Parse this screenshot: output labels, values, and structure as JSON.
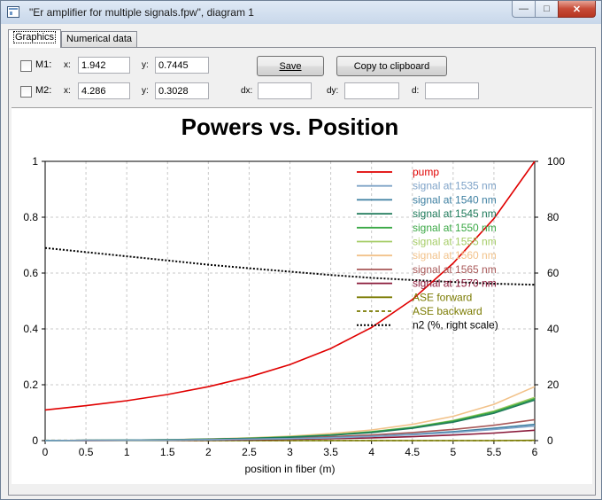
{
  "window": {
    "title": "\"Er amplifier for multiple signals.fpw\", diagram 1",
    "minimize_glyph": "—",
    "maximize_glyph": "□",
    "close_glyph": "✕"
  },
  "tabs": [
    {
      "label": "Graphics",
      "active": true
    },
    {
      "label": "Numerical data",
      "active": false
    }
  ],
  "markers": {
    "m1": {
      "label": "M1:",
      "x_label": "x:",
      "x_value": "1.942",
      "y_label": "y:",
      "y_value": "0.7445",
      "checked": false
    },
    "m2": {
      "label": "M2:",
      "x_label": "x:",
      "x_value": "4.286",
      "y_label": "y:",
      "y_value": "0.3028",
      "checked": false
    },
    "dx_label": "dx:",
    "dx_value": "",
    "dy_label": "dy:",
    "dy_value": "",
    "d_label": "d:",
    "d_value": ""
  },
  "buttons": {
    "save_label": "Save",
    "copy_label": "Copy to clipboard"
  },
  "chart_data": {
    "type": "line",
    "title": "Powers vs. Position",
    "xlabel": "position in fiber (m)",
    "ylabel": "",
    "y2label": "",
    "xlim": [
      0,
      6
    ],
    "ylim": [
      0,
      1
    ],
    "y2lim": [
      0,
      100
    ],
    "x_ticks": [
      "0",
      "0.5",
      "1",
      "1.5",
      "2",
      "2.5",
      "3",
      "3.5",
      "4",
      "4.5",
      "5",
      "5.5",
      "6"
    ],
    "y_ticks": [
      "0",
      "0.2",
      "0.4",
      "0.6",
      "0.8",
      "1"
    ],
    "y2_ticks": [
      "0",
      "20",
      "40",
      "60",
      "80",
      "100"
    ],
    "grid": true,
    "legend_position": "top-right",
    "x": [
      0,
      0.5,
      1,
      1.5,
      2,
      2.5,
      3,
      3.5,
      4,
      4.5,
      5,
      5.5,
      6
    ],
    "series": [
      {
        "name": "pump",
        "color": "#e00000",
        "dash": "solid",
        "axis": "left",
        "values": [
          0.11,
          0.125,
          0.143,
          0.165,
          0.193,
          0.228,
          0.272,
          0.33,
          0.405,
          0.505,
          0.635,
          0.795,
          1.0
        ]
      },
      {
        "name": "signal at 1535 nm",
        "color": "#7fa3c8",
        "dash": "solid",
        "axis": "left",
        "values": [
          0.0,
          0.001,
          0.001,
          0.002,
          0.003,
          0.005,
          0.007,
          0.01,
          0.015,
          0.021,
          0.029,
          0.04,
          0.052
        ]
      },
      {
        "name": "signal at 1540 nm",
        "color": "#3d7fa1",
        "dash": "solid",
        "axis": "left",
        "values": [
          0.0,
          0.001,
          0.001,
          0.002,
          0.003,
          0.005,
          0.007,
          0.011,
          0.016,
          0.023,
          0.032,
          0.044,
          0.058
        ]
      },
      {
        "name": "signal at 1545 nm",
        "color": "#1e7a5a",
        "dash": "solid",
        "axis": "left",
        "values": [
          0.0,
          0.001,
          0.002,
          0.003,
          0.005,
          0.008,
          0.012,
          0.019,
          0.029,
          0.044,
          0.066,
          0.098,
          0.145
        ]
      },
      {
        "name": "signal at 1550 nm",
        "color": "#3aa845",
        "dash": "solid",
        "axis": "left",
        "values": [
          0.0,
          0.001,
          0.002,
          0.003,
          0.005,
          0.008,
          0.013,
          0.02,
          0.031,
          0.047,
          0.07,
          0.103,
          0.15
        ]
      },
      {
        "name": "signal at 1555 nm",
        "color": "#a5cc66",
        "dash": "solid",
        "axis": "left",
        "values": [
          0.0,
          0.001,
          0.002,
          0.003,
          0.005,
          0.009,
          0.014,
          0.021,
          0.032,
          0.048,
          0.072,
          0.106,
          0.155
        ]
      },
      {
        "name": "signal at 1560 nm",
        "color": "#f2c28a",
        "dash": "solid",
        "axis": "left",
        "values": [
          0.0,
          0.001,
          0.002,
          0.003,
          0.006,
          0.01,
          0.016,
          0.025,
          0.038,
          0.058,
          0.087,
          0.13,
          0.193
        ]
      },
      {
        "name": "signal at 1565 nm",
        "color": "#a85858",
        "dash": "solid",
        "axis": "left",
        "values": [
          0.0,
          0.001,
          0.001,
          0.002,
          0.004,
          0.006,
          0.009,
          0.014,
          0.02,
          0.029,
          0.04,
          0.055,
          0.075
        ]
      },
      {
        "name": "signal at 1570 nm",
        "color": "#8a1a3a",
        "dash": "solid",
        "axis": "left",
        "values": [
          0.0,
          0.0,
          0.001,
          0.001,
          0.002,
          0.003,
          0.005,
          0.007,
          0.01,
          0.014,
          0.02,
          0.027,
          0.037
        ]
      },
      {
        "name": "ASE forward",
        "color": "#7a7a00",
        "dash": "solid",
        "axis": "left",
        "values": [
          0.0,
          0.0,
          0.0,
          0.0,
          0.0,
          0.0,
          0.0,
          0.0,
          0.0,
          0.0,
          0.0,
          0.0,
          0.001
        ]
      },
      {
        "name": "ASE backward",
        "color": "#7a7a00",
        "dash": "dashed",
        "axis": "left",
        "values": [
          0.001,
          0.001,
          0.001,
          0.001,
          0.0,
          0.0,
          0.0,
          0.0,
          0.0,
          0.0,
          0.0,
          0.0,
          0.0
        ]
      },
      {
        "name": "n2 (%, right scale)",
        "color": "#000000",
        "dash": "dotted",
        "axis": "right",
        "values": [
          69,
          67.5,
          66,
          64.5,
          63,
          61.7,
          60.5,
          59.3,
          58.3,
          57.5,
          56.8,
          56.2,
          55.8
        ]
      }
    ]
  }
}
